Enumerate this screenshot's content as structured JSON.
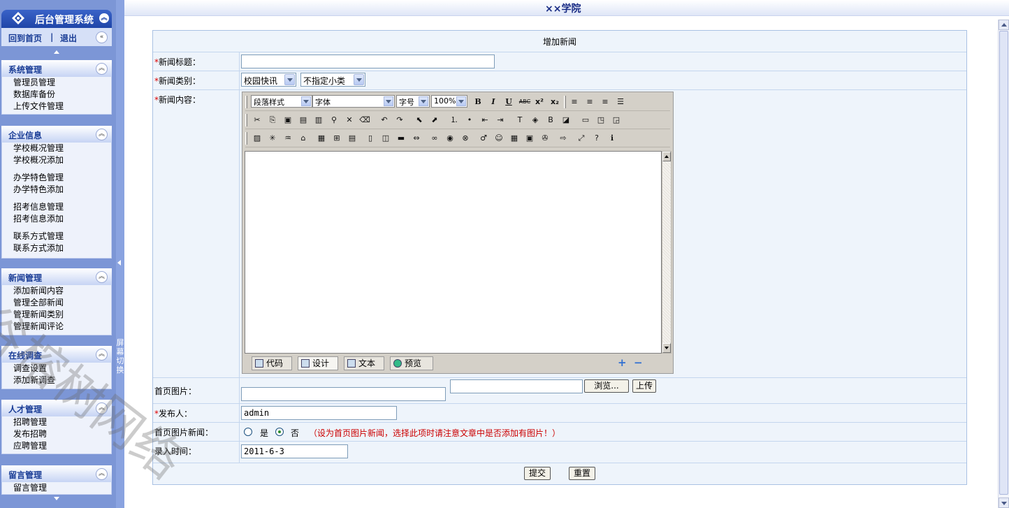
{
  "app": {
    "title": "后台管理系统",
    "college": "××学院"
  },
  "topnav": {
    "home": "回到首页",
    "separator": "|",
    "logout": "退出"
  },
  "sidebar": {
    "sections": [
      {
        "title": "系统管理",
        "items": [
          "管理员管理",
          "数据库备份",
          "上传文件管理"
        ]
      },
      {
        "title": "企业信息",
        "items": [
          "学校概况管理",
          "学校概况添加",
          "办学特色管理",
          "办学特色添加",
          "招考信息管理",
          "招考信息添加",
          "联系方式管理",
          "联系方式添加"
        ]
      },
      {
        "title": "新闻管理",
        "items": [
          "添加新闻内容",
          "管理全部新闻",
          "管理新闻类别",
          "管理新闻评论"
        ]
      },
      {
        "title": "在线调查",
        "items": [
          "调查设置",
          "添加新调查"
        ]
      },
      {
        "title": "人才管理",
        "items": [
          "招聘管理",
          "发布招聘",
          "应聘管理"
        ]
      },
      {
        "title": "留言管理",
        "items": [
          "留言管理"
        ]
      }
    ],
    "divider_text": "屏幕切换"
  },
  "form": {
    "heading": "增加新闻",
    "required_mark": "*",
    "title_label": "新闻标题：",
    "title_value": "",
    "category_label": "新闻类别：",
    "category_main": "校园快讯",
    "category_sub": "不指定小类",
    "content_label": "新闻内容：",
    "cover_label": "首页图片：",
    "cover_path_value": "",
    "cover_file_value": "",
    "browse_label": "浏览...",
    "upload_label": "上传",
    "publisher_label": "发布人：",
    "publisher_value": "admin",
    "cover_news_label": "首页图片新闻：",
    "radio_yes": "是",
    "radio_no": "否",
    "radio_selected": "否",
    "cover_news_hint": "（设为首页图片新闻，选择此项时请注意文章中是否添加有图片！）",
    "date_label": "录入时间：",
    "date_value": "2011-6-3",
    "submit_label": "提交",
    "reset_label": "重置"
  },
  "editor": {
    "paragraph_style": "段落样式",
    "font": "字体",
    "font_size": "字号",
    "zoom": "100%",
    "format_tools": [
      "B",
      "I",
      "U",
      "ABC",
      "x²",
      "x₂"
    ],
    "tabs": [
      "代码",
      "设计",
      "文本",
      "预览"
    ],
    "active_tab": "设计",
    "zoom_in": "+",
    "zoom_out": "−"
  },
  "watermark": "谷榕树网络",
  "colors": {
    "sidebar_bg": "#7c96d6",
    "header_blue": "#1f45a8",
    "title_blue": "#1a2d86",
    "hint_red": "#cc0000",
    "panel_bg": "#eef4fb"
  }
}
